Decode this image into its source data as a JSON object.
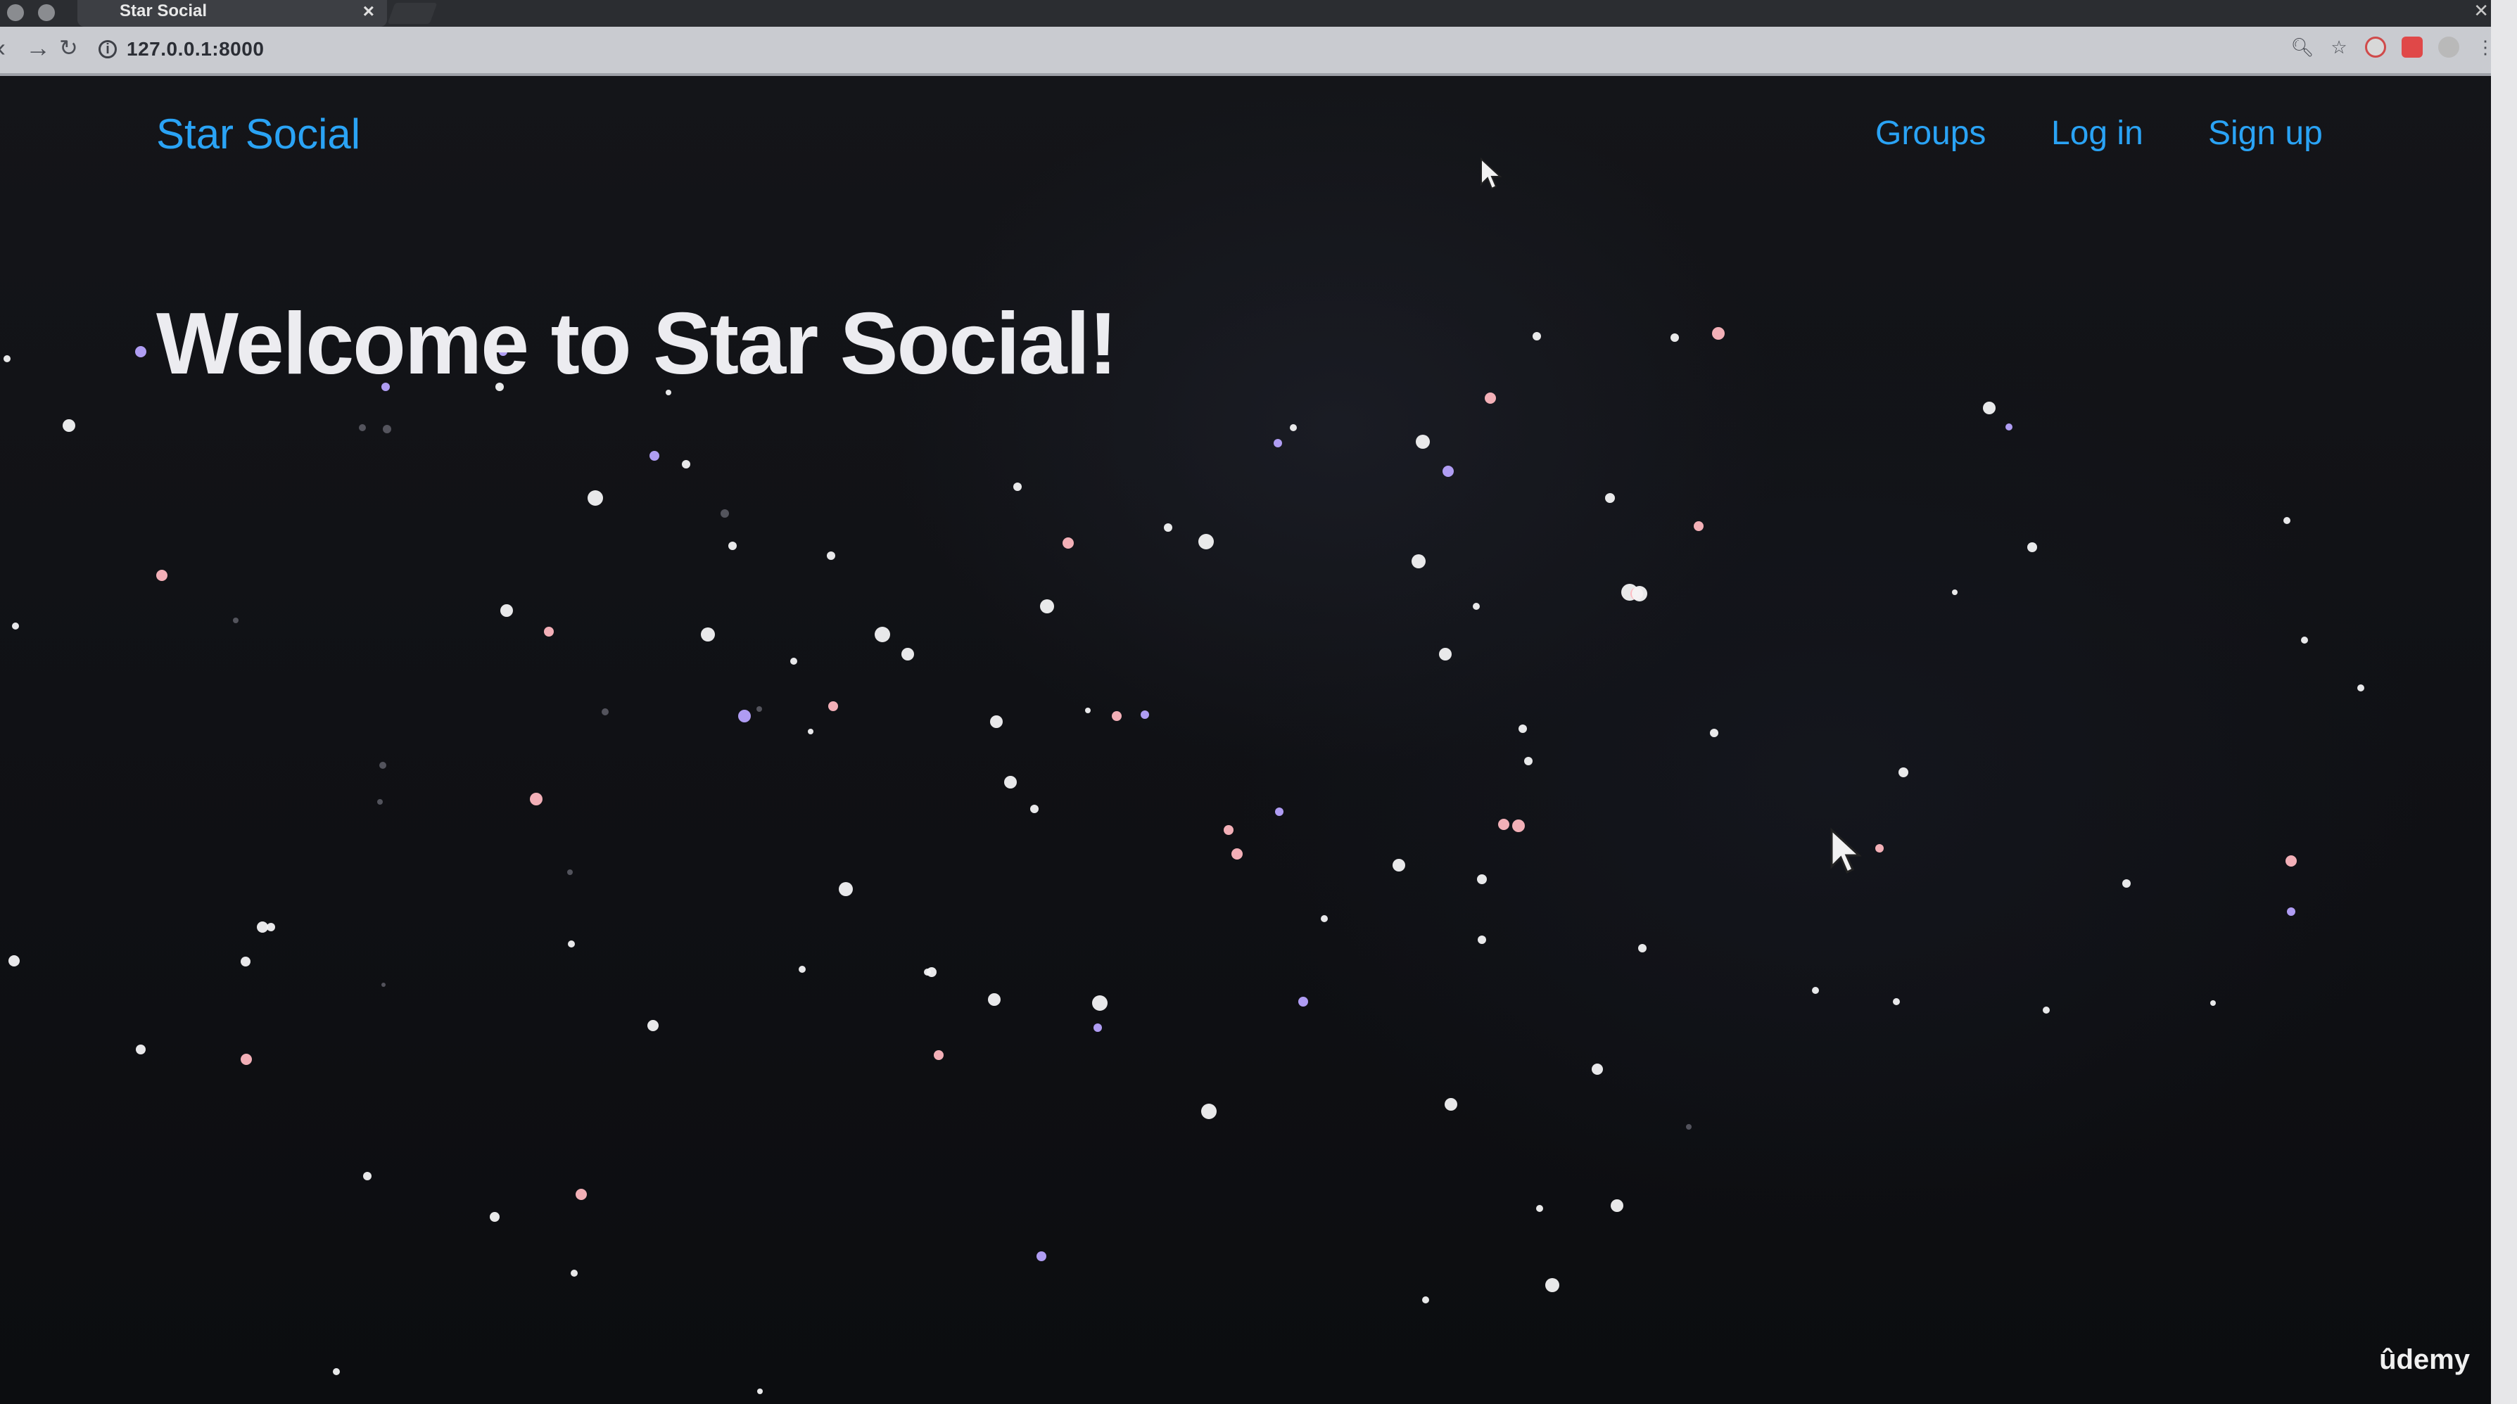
{
  "browser": {
    "tab_title": "Star Social",
    "tab_close": "×",
    "url": "127.0.0.1:8000",
    "window_control": "✕"
  },
  "site": {
    "brand": "Star Social",
    "nav": [
      "Groups",
      "Log in",
      "Sign up"
    ],
    "hero_title": "Welcome to Star Social!"
  },
  "watermark": "ûdemy",
  "colors": {
    "link": "#2aa3f5",
    "background": "#0f1014",
    "hero_text": "#ececf0"
  }
}
